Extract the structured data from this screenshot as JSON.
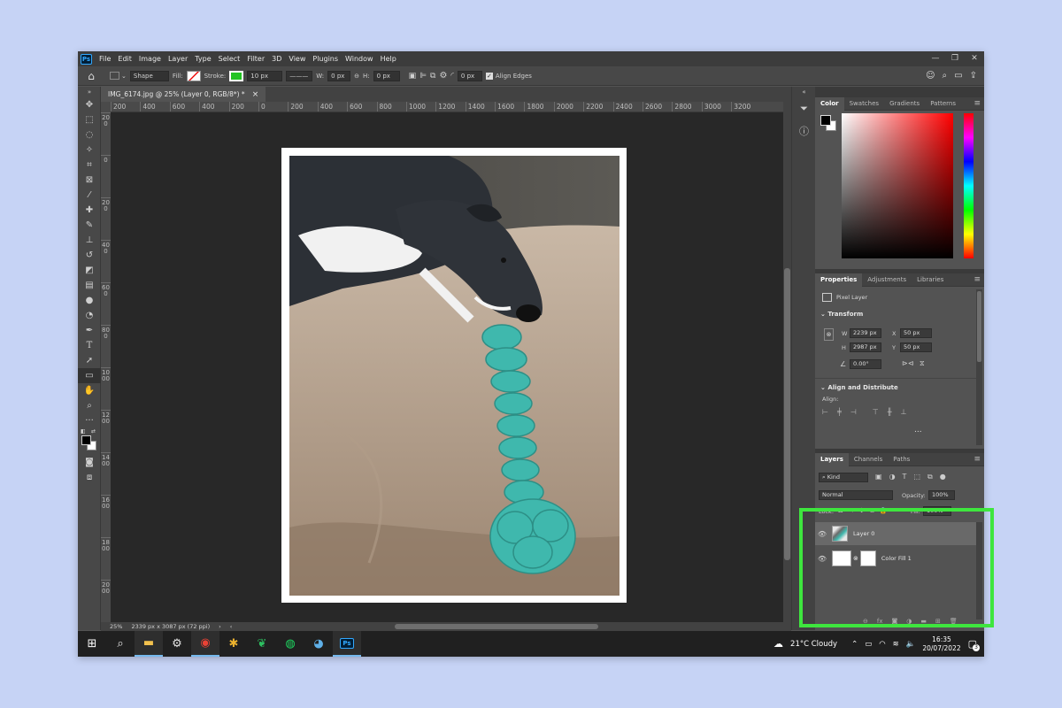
{
  "app": {
    "logo": "Ps",
    "title_tab": "IMG_6174.jpg @ 25% (Layer 0, RGB/8*) *",
    "tab_close": "×"
  },
  "menu": [
    "File",
    "Edit",
    "Image",
    "Layer",
    "Type",
    "Select",
    "Filter",
    "3D",
    "View",
    "Plugins",
    "Window",
    "Help"
  ],
  "window_controls": [
    "—",
    "❐",
    "✕"
  ],
  "options_bar": {
    "shape_mode": "Shape",
    "fill_label": "Fill:",
    "stroke_label": "Stroke:",
    "stroke_width": "10 px",
    "w_label": "W:",
    "w_value": "0 px",
    "h_label": "H:",
    "h_value": "0 px",
    "radius_value": "0 px",
    "align_edges": "Align Edges"
  },
  "ruler_h": [
    "200",
    "400",
    "600",
    "400",
    "200",
    "0",
    "200",
    "400",
    "600",
    "800",
    "1000",
    "1200",
    "1400",
    "1600",
    "1800",
    "2000",
    "2200",
    "2400",
    "2600",
    "2800",
    "3000",
    "3200"
  ],
  "ruler_v": [
    "200",
    "0",
    "200",
    "400",
    "600",
    "800",
    "1000",
    "1200",
    "1400",
    "1600",
    "1800",
    "2000"
  ],
  "status": {
    "zoom": "25%",
    "doc_size": "2339 px x 3087 px (72 ppi)"
  },
  "color_panel": {
    "tabs": [
      "Color",
      "Swatches",
      "Gradients",
      "Patterns"
    ],
    "hue": "#ff0000"
  },
  "properties_panel": {
    "tabs": [
      "Properties",
      "Adjustments",
      "Libraries"
    ],
    "kind": "Pixel Layer",
    "transform_label": "Transform",
    "w_label": "W",
    "w": "2239 px",
    "h_label": "H",
    "h": "2987 px",
    "x_label": "X",
    "x": "50 px",
    "y_label": "Y",
    "y": "50 px",
    "angle": "0.00°",
    "align_label": "Align and Distribute",
    "align_sub": "Align:",
    "more": "..."
  },
  "layers_panel": {
    "tabs": [
      "Layers",
      "Channels",
      "Paths"
    ],
    "filter": "Kind",
    "blend_mode": "Normal",
    "opacity_label": "Opacity:",
    "opacity": "100%",
    "lock_label": "Lock:",
    "fill_label": "Fill:",
    "fill": "100%",
    "layers": [
      {
        "name": "Layer 0"
      },
      {
        "name": "Color Fill 1"
      }
    ]
  },
  "taskbar": {
    "weather": "21°C  Cloudy",
    "time": "16:35",
    "date": "20/07/2022",
    "notifications": "3"
  },
  "colors": {
    "highlight": "#3ee63e",
    "ps_blue": "#31a8ff",
    "teal_toy": "#3fb8ad"
  }
}
